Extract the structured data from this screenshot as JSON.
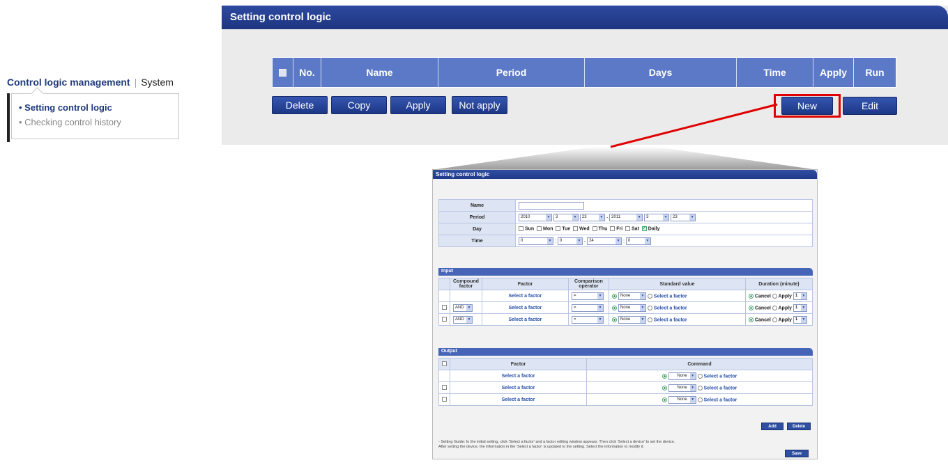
{
  "nav": {
    "tabs": [
      "Control logic management",
      "System"
    ],
    "submenu": [
      "• Setting control logic",
      "• Checking control history"
    ]
  },
  "main": {
    "title": "Setting control logic",
    "columns": [
      "No.",
      "Name",
      "Period",
      "Days",
      "Time",
      "Apply",
      "Run"
    ],
    "buttons": {
      "delete": "Delete",
      "copy": "Copy",
      "apply": "Apply",
      "not_apply": "Not apply",
      "new": "New",
      "edit": "Edit"
    }
  },
  "popup": {
    "title": "Setting control logic",
    "form": {
      "name_label": "Name",
      "name_value": "",
      "period_label": "Period",
      "period": {
        "y1": "2010",
        "m1": "3",
        "d1": "23",
        "y2": "2011",
        "m2": "3",
        "d2": "23"
      },
      "day_label": "Day",
      "days": [
        "Sun",
        "Mon",
        "Tue",
        "Wed",
        "Thu",
        "Fri",
        "Sat",
        "Daily"
      ],
      "time_label": "Time",
      "time": {
        "h1": "0",
        "m1": "0",
        "h2": "24",
        "m2": "0"
      }
    },
    "input": {
      "title": "Input",
      "headers": [
        "Compound factor",
        "Factor",
        "Comparison operator",
        "Standard value",
        "Duration (minute)"
      ],
      "select_factor": "Select a factor",
      "operator": "=",
      "none": "None",
      "cancel": "Cancel",
      "apply": "Apply",
      "duration": "1",
      "compound": "AND"
    },
    "output": {
      "title": "Output",
      "headers": [
        "Factor",
        "Command"
      ],
      "select_factor": "Select a factor",
      "none": "None"
    },
    "buttons": {
      "add": "Add",
      "delete": "Delete",
      "save": "Save"
    },
    "guide": [
      "- Setting Guide: In the initial setting, click 'Select a factor' and a factor editing window appears. Then click 'Select a device' to set the device.",
      "After setting the device, the information in the 'Select a factor' is updated to the setting. Select the information to modify it."
    ]
  }
}
